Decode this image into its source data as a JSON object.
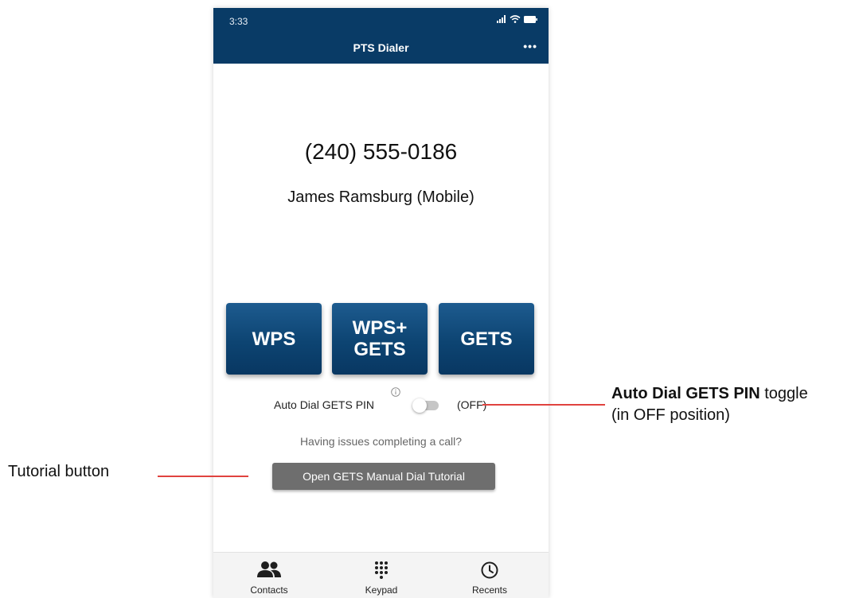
{
  "status_bar": {
    "time": "3:33"
  },
  "header": {
    "title": "PTS Dialer",
    "more_label": "•••"
  },
  "call": {
    "phone_number": "(240) 555-0186",
    "contact_name": "James Ramsburg (Mobile)"
  },
  "dial_buttons": [
    {
      "lines": [
        "WPS"
      ]
    },
    {
      "lines": [
        "WPS+",
        "GETS"
      ]
    },
    {
      "lines": [
        "GETS"
      ]
    }
  ],
  "auto_dial": {
    "label": "Auto Dial GETS PIN",
    "state_label": "(OFF)",
    "enabled": false
  },
  "help": {
    "issues_text": "Having issues completing a call?",
    "tutorial_button_label": "Open GETS Manual Dial Tutorial"
  },
  "bottom_nav": [
    {
      "label": "Contacts",
      "icon": "contacts-icon"
    },
    {
      "label": "Keypad",
      "icon": "keypad-icon"
    },
    {
      "label": "Recents",
      "icon": "recents-clock-icon"
    }
  ],
  "annotations": {
    "toggle_note_bold": "Auto Dial GETS PIN",
    "toggle_note_rest": " toggle",
    "toggle_note_line2": "(in OFF position)",
    "tutorial_note": "Tutorial button"
  },
  "colors": {
    "header_bg": "#093b66",
    "dial_button": "#0d4472",
    "tutorial_button": "#6e6e6e",
    "annotation_line": "#e0433f"
  }
}
